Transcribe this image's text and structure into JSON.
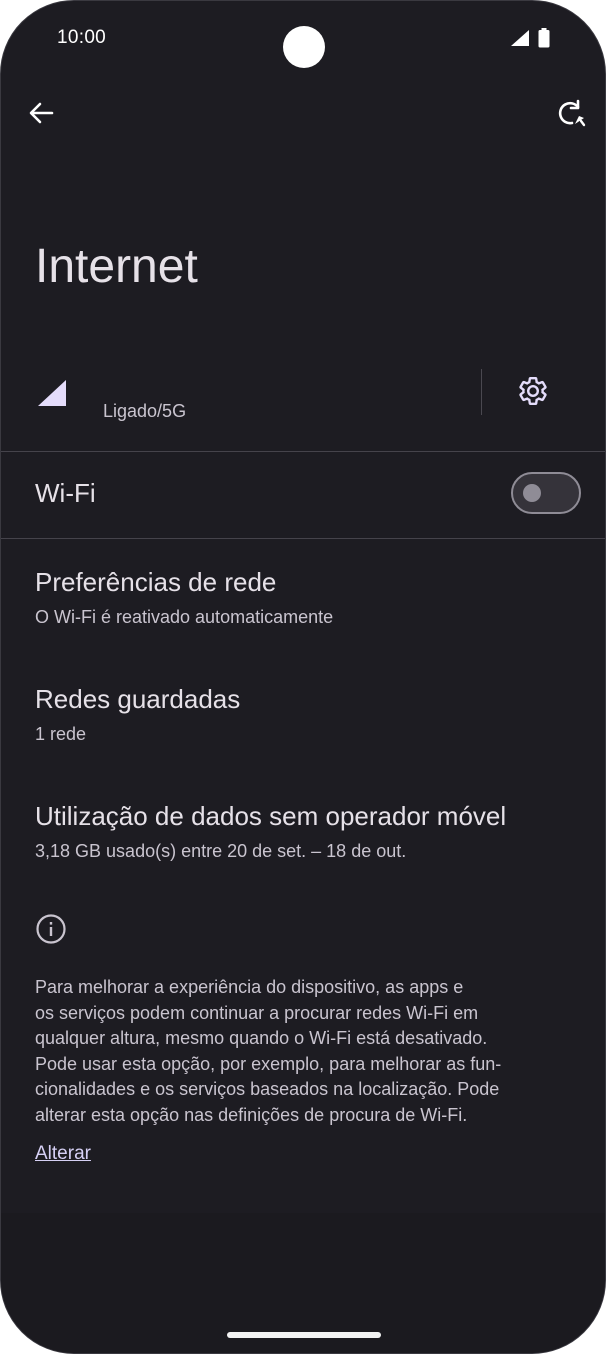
{
  "status_bar": {
    "time": "10:00",
    "icons": [
      "signal-icon",
      "battery-icon"
    ]
  },
  "top_bar": {
    "back_icon": "arrow-back-icon",
    "refresh_icon": "refresh-icon"
  },
  "page": {
    "title": "Internet"
  },
  "mobile_network": {
    "status": "Ligado/5G",
    "signal_icon": "cellular-signal-icon",
    "settings_icon": "gear-icon"
  },
  "wifi": {
    "label": "Wi-Fi",
    "enabled": false
  },
  "items": [
    {
      "title": "Preferências de rede",
      "subtitle": "O Wi-Fi é reativado automaticamente"
    },
    {
      "title": "Redes guardadas",
      "subtitle": "1 rede"
    },
    {
      "title": "Utilização de dados sem operador móvel",
      "subtitle": "3,18 GB usado(s) entre 20 de set. – 18 de out."
    }
  ],
  "info": {
    "icon": "info-icon",
    "lines": [
      "Para melhorar a experiência do dispositivo, as apps e",
      "os serviços podem continuar a procurar redes Wi-Fi em",
      "qualquer altura, mesmo quando o Wi-Fi está desativado.",
      "Pode usar esta opção, por exemplo, para melhorar as fun-",
      "cionalidades e os serviços baseados na localização. Pode",
      "alterar esta opção nas definições de procura de Wi-Fi."
    ],
    "link": "Alterar"
  },
  "colors": {
    "background": "#1d1c22",
    "text_primary": "#e6e1e8",
    "text_secondary": "#c9c4cf",
    "accent": "#d6d0f5",
    "divider": "#45434b"
  }
}
